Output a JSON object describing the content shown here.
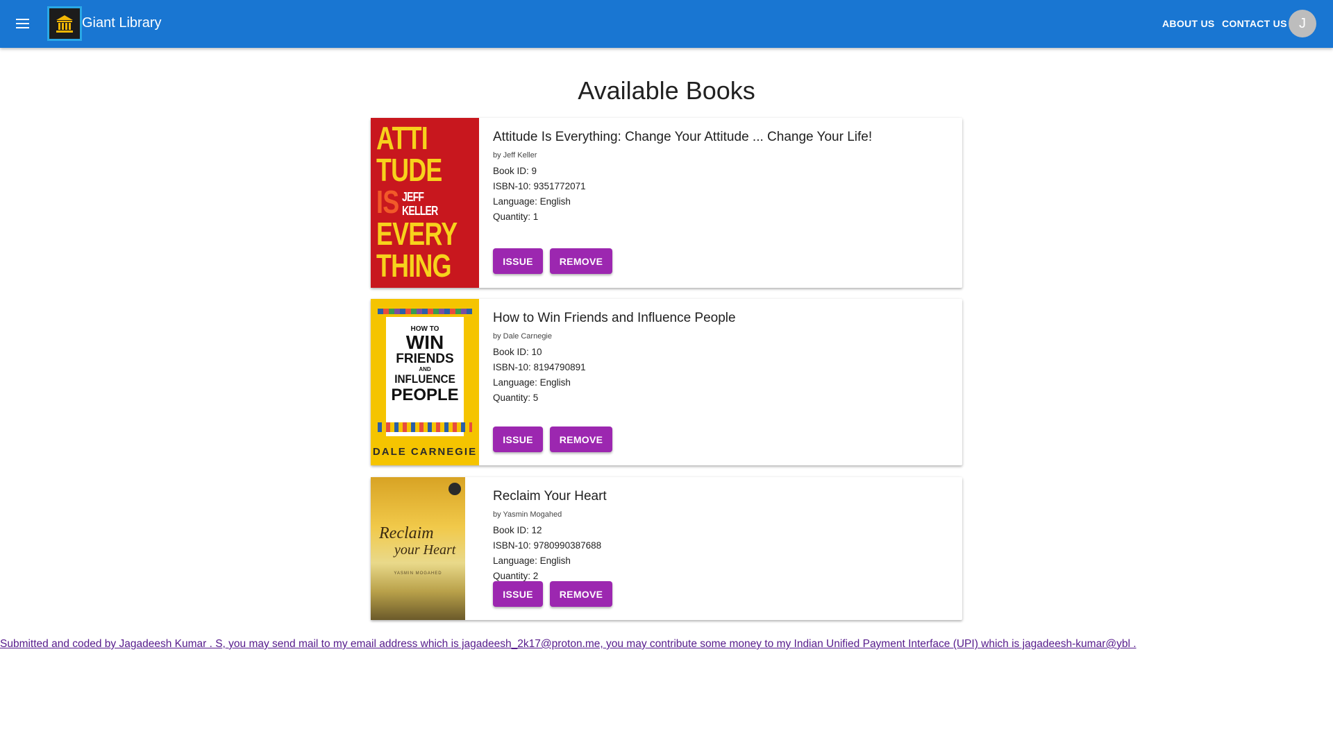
{
  "header": {
    "brand": "Giant Library",
    "nav": [
      "ABOUT US",
      "CONTACT US"
    ],
    "avatar_initial": "J",
    "color": "#1976d2"
  },
  "main": {
    "title": "Available Books",
    "books": [
      {
        "title": "Attitude Is Everything: Change Your Attitude ... Change Your Life!",
        "author": "by Jeff Keller",
        "book_id": "Book ID: 9",
        "isbn": "ISBN-10: 9351772071",
        "language": "Language: English",
        "quantity": "Quantity: 1",
        "issue_label": "ISSUE",
        "remove_label": "REMOVE",
        "cover_lines": [
          "ATTI",
          "TUDE",
          "IS",
          "JEFF KELLER",
          "EVERY",
          "THING"
        ]
      },
      {
        "title": "How to Win Friends and Influence People",
        "author": "by Dale Carnegie",
        "book_id": "Book ID: 10",
        "isbn": "ISBN-10: 8194790891",
        "language": "Language: English",
        "quantity": "Quantity: 5",
        "issue_label": "ISSUE",
        "remove_label": "REMOVE",
        "cover_lines": [
          "HOW TO",
          "WIN",
          "FRIENDS",
          "AND",
          "INFLUENCE",
          "PEOPLE",
          "DALE CARNEGIE"
        ]
      },
      {
        "title": "Reclaim Your Heart",
        "author": "by Yasmin Mogahed",
        "book_id": "Book ID: 12",
        "isbn": "ISBN-10: 9780990387688",
        "language": "Language: English",
        "quantity": "Quantity: 2",
        "issue_label": "ISSUE",
        "remove_label": "REMOVE",
        "cover_lines": [
          "Reclaim",
          "your Heart",
          "YASMIN MOGAHED"
        ]
      }
    ],
    "accent": "#9c27b0"
  },
  "footer": {
    "text": "Submitted and coded by Jagadeesh Kumar . S, you may send mail to my email address which is jagadeesh_2k17@proton.me, you may contribute some money to my Indian Unified Payment Interface (UPI) which is jagadeesh-kumar@ybl ."
  }
}
